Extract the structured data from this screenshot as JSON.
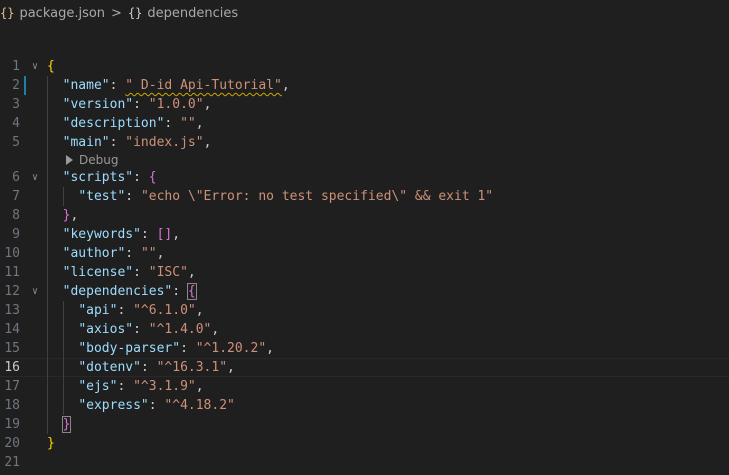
{
  "breadcrumb": {
    "file_icon": "{}",
    "file_name": "package.json",
    "separator": ">",
    "symbol_icon": "{}",
    "symbol_name": "dependencies"
  },
  "codelens": {
    "debug_label": "Debug",
    "icon": "play-icon"
  },
  "lines": [
    {
      "n": "1",
      "parts": [
        [
          "b1",
          "{"
        ]
      ]
    },
    {
      "n": "2",
      "parts": [
        [
          "p",
          "  "
        ],
        [
          "k",
          "\"name\""
        ],
        [
          "p",
          ": "
        ],
        [
          "s",
          "\" D-id Api-Tutorial\""
        ],
        [
          "p",
          ","
        ]
      ]
    },
    {
      "n": "3",
      "parts": [
        [
          "p",
          "  "
        ],
        [
          "k",
          "\"version\""
        ],
        [
          "p",
          ": "
        ],
        [
          "s",
          "\"1.0.0\""
        ],
        [
          "p",
          ","
        ]
      ]
    },
    {
      "n": "4",
      "parts": [
        [
          "p",
          "  "
        ],
        [
          "k",
          "\"description\""
        ],
        [
          "p",
          ": "
        ],
        [
          "s",
          "\"\""
        ],
        [
          "p",
          ","
        ]
      ]
    },
    {
      "n": "5",
      "parts": [
        [
          "p",
          "  "
        ],
        [
          "k",
          "\"main\""
        ],
        [
          "p",
          ": "
        ],
        [
          "s",
          "\"index.js\""
        ],
        [
          "p",
          ","
        ]
      ]
    },
    {
      "n": "6",
      "parts": [
        [
          "p",
          "  "
        ],
        [
          "k",
          "\"scripts\""
        ],
        [
          "p",
          ": "
        ],
        [
          "b2",
          "{"
        ]
      ]
    },
    {
      "n": "7",
      "parts": [
        [
          "p",
          "    "
        ],
        [
          "k",
          "\"test\""
        ],
        [
          "p",
          ": "
        ],
        [
          "s",
          "\"echo \\\"Error: no test specified\\\" && exit 1\""
        ]
      ]
    },
    {
      "n": "8",
      "parts": [
        [
          "p",
          "  "
        ],
        [
          "b2",
          "}"
        ],
        [
          "p",
          ","
        ]
      ]
    },
    {
      "n": "9",
      "parts": [
        [
          "p",
          "  "
        ],
        [
          "k",
          "\"keywords\""
        ],
        [
          "p",
          ": "
        ],
        [
          "b2",
          "[]"
        ],
        [
          "p",
          ","
        ]
      ]
    },
    {
      "n": "10",
      "parts": [
        [
          "p",
          "  "
        ],
        [
          "k",
          "\"author\""
        ],
        [
          "p",
          ": "
        ],
        [
          "s",
          "\"\""
        ],
        [
          "p",
          ","
        ]
      ]
    },
    {
      "n": "11",
      "parts": [
        [
          "p",
          "  "
        ],
        [
          "k",
          "\"license\""
        ],
        [
          "p",
          ": "
        ],
        [
          "s",
          "\"ISC\""
        ],
        [
          "p",
          ","
        ]
      ]
    },
    {
      "n": "12",
      "parts": [
        [
          "p",
          "  "
        ],
        [
          "k",
          "\"dependencies\""
        ],
        [
          "p",
          ": "
        ],
        [
          "b2",
          "{"
        ]
      ]
    },
    {
      "n": "13",
      "parts": [
        [
          "p",
          "    "
        ],
        [
          "k",
          "\"api\""
        ],
        [
          "p",
          ": "
        ],
        [
          "s",
          "\"^6.1.0\""
        ],
        [
          "p",
          ","
        ]
      ]
    },
    {
      "n": "14",
      "parts": [
        [
          "p",
          "    "
        ],
        [
          "k",
          "\"axios\""
        ],
        [
          "p",
          ": "
        ],
        [
          "s",
          "\"^1.4.0\""
        ],
        [
          "p",
          ","
        ]
      ]
    },
    {
      "n": "15",
      "parts": [
        [
          "p",
          "    "
        ],
        [
          "k",
          "\"body-parser\""
        ],
        [
          "p",
          ": "
        ],
        [
          "s",
          "\"^1.20.2\""
        ],
        [
          "p",
          ","
        ]
      ]
    },
    {
      "n": "16",
      "parts": [
        [
          "p",
          "    "
        ],
        [
          "k",
          "\"dotenv\""
        ],
        [
          "p",
          ": "
        ],
        [
          "s",
          "\"^16.3.1\""
        ],
        [
          "p",
          ","
        ]
      ]
    },
    {
      "n": "17",
      "parts": [
        [
          "p",
          "    "
        ],
        [
          "k",
          "\"ejs\""
        ],
        [
          "p",
          ": "
        ],
        [
          "s",
          "\"^3.1.9\""
        ],
        [
          "p",
          ","
        ]
      ]
    },
    {
      "n": "18",
      "parts": [
        [
          "p",
          "    "
        ],
        [
          "k",
          "\"express\""
        ],
        [
          "p",
          ": "
        ],
        [
          "s",
          "\"^4.18.2\""
        ]
      ]
    },
    {
      "n": "19",
      "parts": [
        [
          "p",
          "  "
        ],
        [
          "b2",
          "}"
        ]
      ]
    },
    {
      "n": "20",
      "parts": [
        [
          "b1",
          "}"
        ]
      ]
    },
    {
      "n": "21",
      "parts": []
    }
  ],
  "colors": {
    "background": "#1f1f1f",
    "key": "#9cdcfe",
    "string": "#ce9178",
    "punctuation": "#cccccc",
    "bracket_level_1": "#ffd700",
    "bracket_level_2": "#da70d6",
    "line_number": "#6e7681",
    "warning_squiggle": "#cca700"
  }
}
